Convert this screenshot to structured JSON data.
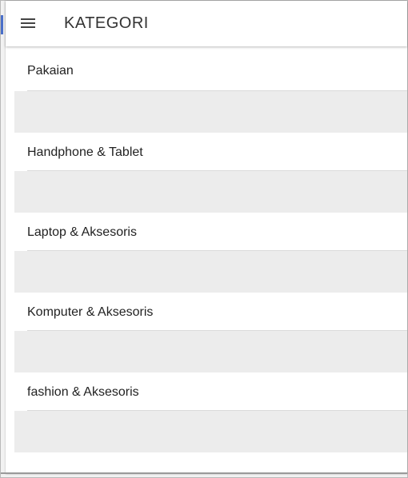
{
  "header": {
    "title": "KATEGORI",
    "menu_icon": "hamburger-menu-icon"
  },
  "categories": [
    {
      "label": "Pakaian"
    },
    {
      "label": "Handphone & Tablet"
    },
    {
      "label": "Laptop & Aksesoris"
    },
    {
      "label": "Komputer & Aksesoris"
    },
    {
      "label": "fashion & Aksesoris"
    }
  ],
  "colors": {
    "appbar_bg": "#ffffff",
    "spacer_bg": "#ececec",
    "text": "#222222"
  }
}
